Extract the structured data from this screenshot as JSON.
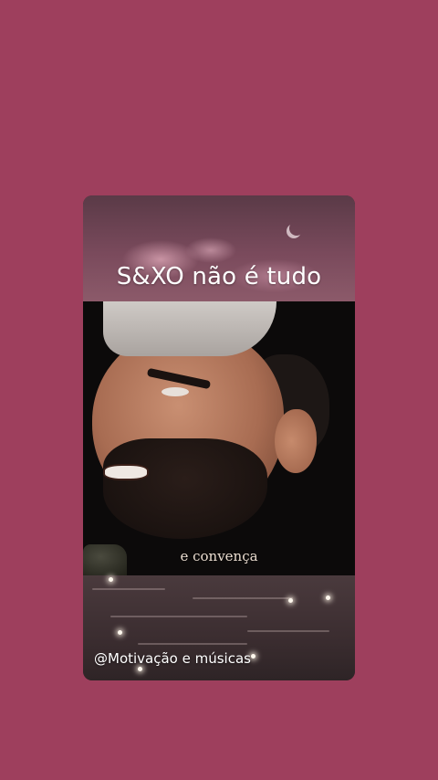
{
  "story": {
    "title": "S&XO não é tudo",
    "subtitle": "e convença",
    "handle": "@Motivação e músicas"
  },
  "colors": {
    "background": "#9e3f5d",
    "title_text": "#ffffff",
    "subtitle_text": "#e9dccf"
  },
  "icons": {
    "moon": "crescent-moon-icon"
  }
}
